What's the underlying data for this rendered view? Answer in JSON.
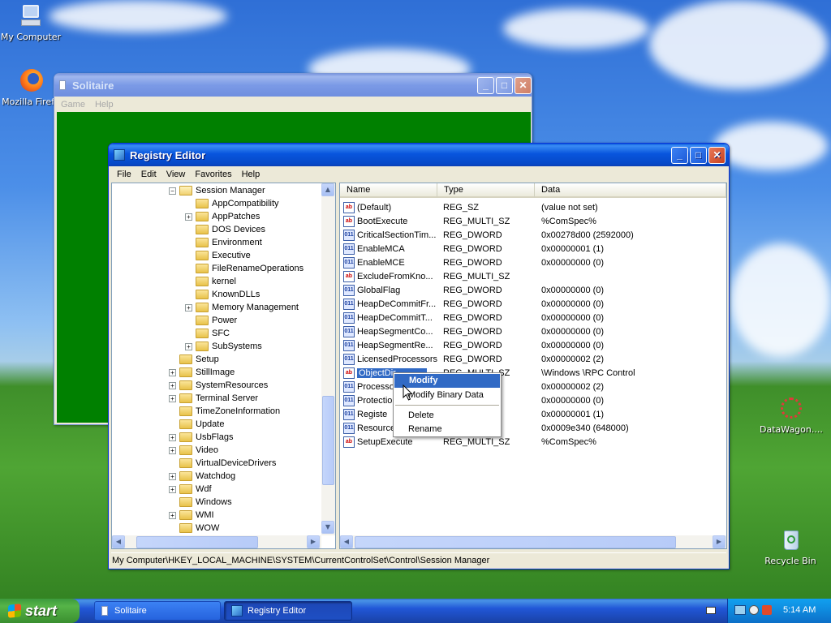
{
  "desktop": {
    "icons": [
      {
        "label": "My Computer",
        "icon": "computer-icon"
      },
      {
        "label": "Mozilla Firefo",
        "icon": "firefox-icon"
      },
      {
        "label": "DataWagon....",
        "icon": "network-icon"
      },
      {
        "label": "Recycle Bin",
        "icon": "recycle-bin-icon"
      }
    ]
  },
  "solitaire": {
    "title": "Solitaire",
    "menu": [
      "Game",
      "Help"
    ],
    "felt_color": "#008000"
  },
  "regedit": {
    "title": "Registry Editor",
    "menu": [
      "File",
      "Edit",
      "View",
      "Favorites",
      "Help"
    ],
    "tree": [
      {
        "label": "Session Manager",
        "expander": "−",
        "open": true
      },
      {
        "label": "AppCompatibility",
        "expander": ""
      },
      {
        "label": "AppPatches",
        "expander": "+"
      },
      {
        "label": "DOS Devices",
        "expander": ""
      },
      {
        "label": "Environment",
        "expander": ""
      },
      {
        "label": "Executive",
        "expander": ""
      },
      {
        "label": "FileRenameOperations",
        "expander": ""
      },
      {
        "label": "kernel",
        "expander": ""
      },
      {
        "label": "KnownDLLs",
        "expander": ""
      },
      {
        "label": "Memory Management",
        "expander": "+"
      },
      {
        "label": "Power",
        "expander": ""
      },
      {
        "label": "SFC",
        "expander": ""
      },
      {
        "label": "SubSystems",
        "expander": "+"
      },
      {
        "label": "Setup",
        "expander": ""
      },
      {
        "label": "StillImage",
        "expander": "+"
      },
      {
        "label": "SystemResources",
        "expander": "+"
      },
      {
        "label": "Terminal Server",
        "expander": "+"
      },
      {
        "label": "TimeZoneInformation",
        "expander": ""
      },
      {
        "label": "Update",
        "expander": ""
      },
      {
        "label": "UsbFlags",
        "expander": "+"
      },
      {
        "label": "Video",
        "expander": "+"
      },
      {
        "label": "VirtualDeviceDrivers",
        "expander": ""
      },
      {
        "label": "Watchdog",
        "expander": "+"
      },
      {
        "label": "Wdf",
        "expander": "+"
      },
      {
        "label": "Windows",
        "expander": ""
      },
      {
        "label": "WMI",
        "expander": "+"
      },
      {
        "label": "WOW",
        "expander": ""
      }
    ],
    "columns": [
      "Name",
      "Type",
      "Data"
    ],
    "values": [
      {
        "name": "(Default)",
        "type": "REG_SZ",
        "data": "(value not set)",
        "icon": "sz"
      },
      {
        "name": "BootExecute",
        "type": "REG_MULTI_SZ",
        "data": "%ComSpec%",
        "icon": "sz"
      },
      {
        "name": "CriticalSectionTim...",
        "type": "REG_DWORD",
        "data": "0x00278d00 (2592000)",
        "icon": "bin"
      },
      {
        "name": "EnableMCA",
        "type": "REG_DWORD",
        "data": "0x00000001 (1)",
        "icon": "bin"
      },
      {
        "name": "EnableMCE",
        "type": "REG_DWORD",
        "data": "0x00000000 (0)",
        "icon": "bin"
      },
      {
        "name": "ExcludeFromKno...",
        "type": "REG_MULTI_SZ",
        "data": "",
        "icon": "sz"
      },
      {
        "name": "GlobalFlag",
        "type": "REG_DWORD",
        "data": "0x00000000 (0)",
        "icon": "bin"
      },
      {
        "name": "HeapDeCommitFr...",
        "type": "REG_DWORD",
        "data": "0x00000000 (0)",
        "icon": "bin"
      },
      {
        "name": "HeapDeCommitT...",
        "type": "REG_DWORD",
        "data": "0x00000000 (0)",
        "icon": "bin"
      },
      {
        "name": "HeapSegmentCo...",
        "type": "REG_DWORD",
        "data": "0x00000000 (0)",
        "icon": "bin"
      },
      {
        "name": "HeapSegmentRe...",
        "type": "REG_DWORD",
        "data": "0x00000000 (0)",
        "icon": "bin"
      },
      {
        "name": "LicensedProcessors",
        "type": "REG_DWORD",
        "data": "0x00000002 (2)",
        "icon": "bin"
      },
      {
        "name": "ObjectDir",
        "type": "REG_MULTI_SZ",
        "data": "\\Windows \\RPC Control",
        "icon": "sz",
        "selected": true
      },
      {
        "name": "Processo",
        "type": "",
        "data": "0x00000002 (2)",
        "icon": "bin"
      },
      {
        "name": "Protection",
        "type": "",
        "data": "0x00000000 (0)",
        "icon": "bin"
      },
      {
        "name": "Registe",
        "type": "",
        "data": "0x00000001 (1)",
        "icon": "bin"
      },
      {
        "name": "Resource",
        "type": "",
        "data": "0x0009e340 (648000)",
        "icon": "bin"
      },
      {
        "name": "SetupExecute",
        "type": "REG_MULTI_SZ",
        "data": "%ComSpec%",
        "icon": "sz"
      }
    ],
    "context_menu": [
      "Modify",
      "Modify Binary Data",
      "Delete",
      "Rename"
    ],
    "status_path": "My Computer\\HKEY_LOCAL_MACHINE\\SYSTEM\\CurrentControlSet\\Control\\Session Manager"
  },
  "taskbar": {
    "start_label": "start",
    "tasks": [
      {
        "label": "Solitaire",
        "active": false
      },
      {
        "label": "Registry Editor",
        "active": true
      }
    ],
    "clock": "5:14 AM"
  }
}
